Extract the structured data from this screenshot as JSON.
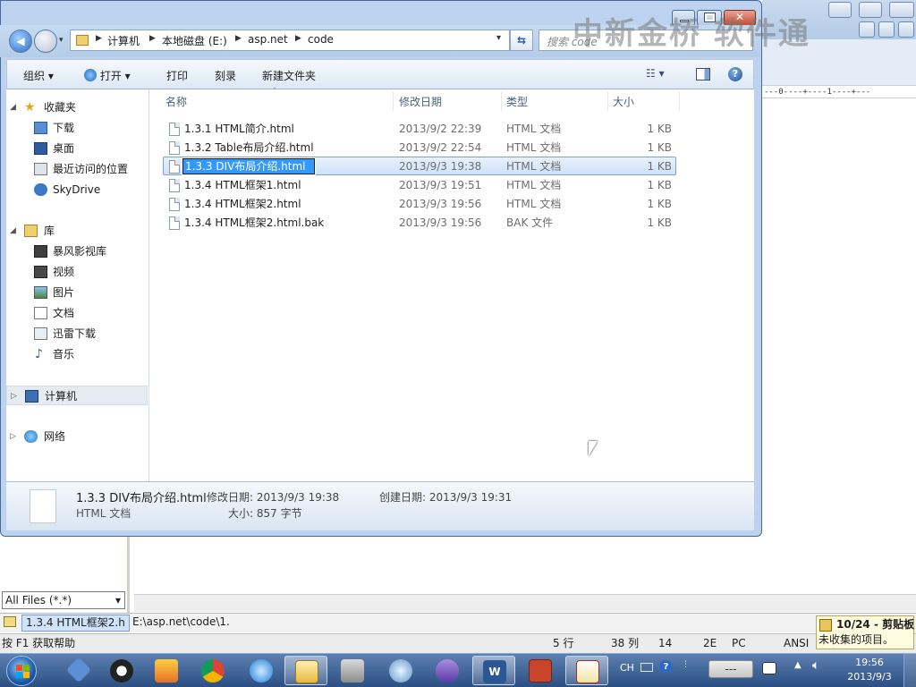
{
  "watermark": "中新金桥 软件通",
  "editor": {
    "ruler": "---0----+----1----+---",
    "filter_value": "All Files (*.*)",
    "tabs": [
      "1.3.4 HTML框架2.h",
      "E:\\asp.net\\code\\1."
    ],
    "status": {
      "help": "按 F1 获取帮助",
      "row": "5 行",
      "col": "38 列",
      "n1": "14",
      "n2": "2E",
      "eol": "PC",
      "enc": "ANSI"
    },
    "clipboard": {
      "title": "10/24 - 剪贴板",
      "text": "未收集的项目。"
    }
  },
  "explorer": {
    "breadcrumb": [
      "计算机",
      "本地磁盘 (E:)",
      "asp.net",
      "code"
    ],
    "search_placeholder": "搜索 code",
    "toolbar": {
      "organize": "组织",
      "open": "打开",
      "print": "打印",
      "burn": "刻录",
      "new_folder": "新建文件夹"
    },
    "sidebar": {
      "favorites": "收藏夹",
      "fav_items": [
        "下载",
        "桌面",
        "最近访问的位置",
        "SkyDrive"
      ],
      "libraries": "库",
      "lib_items": [
        "暴风影视库",
        "视频",
        "图片",
        "文档",
        "迅雷下载",
        "音乐"
      ],
      "computer": "计算机",
      "network": "网络"
    },
    "columns": {
      "name": "名称",
      "date": "修改日期",
      "type": "类型",
      "size": "大小"
    },
    "files": [
      {
        "name": "1.3.1 HTML简介.html",
        "date": "2013/9/2 22:39",
        "type": "HTML 文档",
        "size": "1 KB"
      },
      {
        "name": "1.3.2 Table布局介绍.html",
        "date": "2013/9/2 22:54",
        "type": "HTML 文档",
        "size": "1 KB"
      },
      {
        "name": "1.3.3 DIV布局介绍.html",
        "date": "2013/9/3 19:38",
        "type": "HTML 文档",
        "size": "1 KB"
      },
      {
        "name": "1.3.4 HTML框架1.html",
        "date": "2013/9/3 19:51",
        "type": "HTML 文档",
        "size": "1 KB"
      },
      {
        "name": "1.3.4 HTML框架2.html",
        "date": "2013/9/3 19:56",
        "type": "HTML 文档",
        "size": "1 KB"
      },
      {
        "name": "1.3.4 HTML框架2.html.bak",
        "date": "2013/9/3 19:56",
        "type": "BAK 文件",
        "size": "1 KB"
      }
    ],
    "details": {
      "filename": "1.3.3 DIV布局介绍.html",
      "filetype": "HTML 文档",
      "modified": "修改日期: 2013/9/3 19:38",
      "created": "创建日期: 2013/9/3 19:31",
      "size": "大小: 857 字节"
    }
  },
  "taskbar": {
    "lang": "CH",
    "time": "19:56",
    "date": "2013/9/3"
  }
}
